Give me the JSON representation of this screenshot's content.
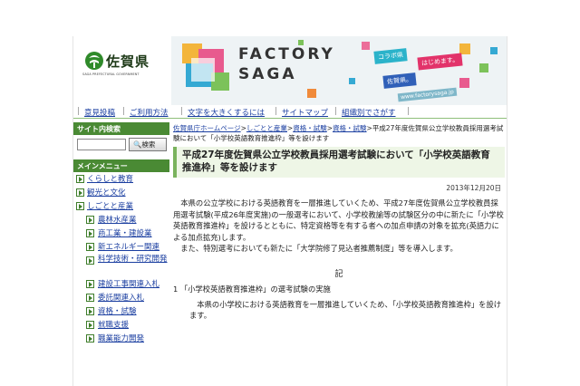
{
  "logo": {
    "name": "佐賀県",
    "sub": "SAGA PREFECTURAL GOVERNMENT"
  },
  "banner": {
    "title1": "FACTORY",
    "title2": "SAGA",
    "tag1": "コラボ県",
    "tag2": "はじめます。",
    "tag3": "佐賀県。",
    "url": "www.factorysaga.jp"
  },
  "nav": [
    "意見投稿",
    "ご利用方法",
    "文字を大きくするには",
    "サイトマップ",
    "組織別でさがす"
  ],
  "sidebar": {
    "search_heading": "サイト内検索",
    "search_button": "検索",
    "menu_heading": "メインメニュー",
    "items": [
      {
        "label": "くらしと教育",
        "level": 1
      },
      {
        "label": "観光と文化",
        "level": 1
      },
      {
        "label": "しごとと産業",
        "level": 1
      },
      {
        "label": "農林水産業",
        "level": 2
      },
      {
        "label": "商工業・建設業",
        "level": 2
      },
      {
        "label": "新エネルギー関連",
        "level": 2
      },
      {
        "label": "科学技術・研究開発",
        "level": 2
      },
      {
        "label": "建設工事関連入札",
        "level": 2
      },
      {
        "label": "委託関連入札",
        "level": 2
      },
      {
        "label": "資格・試験",
        "level": 2
      },
      {
        "label": "就職支援",
        "level": 2
      },
      {
        "label": "職業能力開発",
        "level": 2
      }
    ]
  },
  "breadcrumb": {
    "links": [
      "佐賀県庁ホームページ",
      "しごとと産業",
      "資格・試験",
      "資格・試験"
    ],
    "current": "平成27年度佐賀県公立学校教員採用選考試験において「小学校英語教育推進枠」等を設けます",
    "separator": ">"
  },
  "article": {
    "title": "平成27年度佐賀県公立学校教員採用選考試験において「小学校英語教育推進枠」等を設けます",
    "date": "2013年12月20日",
    "p1": "本県の公立学校における英語教育を一層推進していくため、平成27年度佐賀県公立学校教員採用選考試験(平成26年度実施)の一般選考において、小学校教諭等の試験区分の中に新たに「小学校英語教育推進枠」を設けるとともに、特定資格等を有する者への加点申請の対象を拡充(英語力による加点拡充)します。",
    "p2": "また、特別選考においても新たに「大学院修了見込者推薦制度」等を導入します。",
    "ki": "記",
    "sec1": "1 「小学校英語教育推進枠」の選考試験の実施",
    "sec1_body": "本県の小学校における英語教育を一層推進していくため、「小学校英語教育推進枠」を設けます。"
  }
}
